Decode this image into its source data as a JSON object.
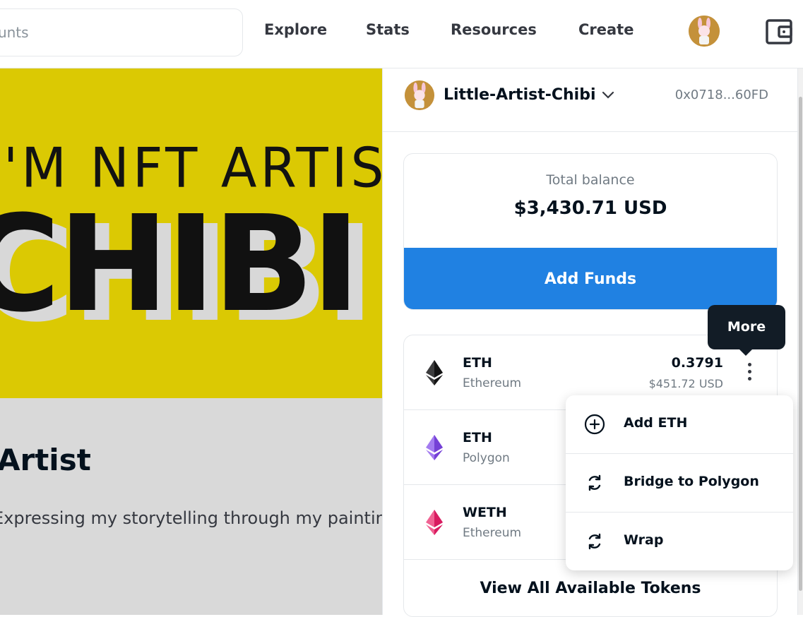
{
  "header": {
    "search_placeholder": "Search items, collections, and accounts",
    "nav": [
      "Explore",
      "Stats",
      "Resources",
      "Create"
    ]
  },
  "profile": {
    "banner_line1": "I'M NFT ARTIST",
    "banner_line2": "CHIBI",
    "title": "Artist",
    "description": "Expressing my storytelling through my paintings. ..."
  },
  "wallet": {
    "account_name": "Little-Artist-Chibi",
    "address": "0x0718...60FD",
    "balance_label": "Total balance",
    "balance_value": "$3,430.71 USD",
    "add_funds_label": "Add Funds",
    "tokens": [
      {
        "symbol": "ETH",
        "chain": "Ethereum",
        "amount": "0.3791",
        "usd": "$451.72 USD",
        "color": "#3c3c3d"
      },
      {
        "symbol": "ETH",
        "chain": "Polygon",
        "amount": "",
        "usd": "",
        "color": "#8247e5"
      },
      {
        "symbol": "WETH",
        "chain": "Ethereum",
        "amount": "",
        "usd": "",
        "color": "#ec407a"
      }
    ],
    "view_all_label": "View All Available Tokens"
  },
  "tooltip": {
    "label": "More"
  },
  "menu": {
    "items": [
      {
        "label": "Add ETH",
        "icon": "plus-circle-icon"
      },
      {
        "label": "Bridge to Polygon",
        "icon": "refresh-icon"
      },
      {
        "label": "Wrap",
        "icon": "refresh-icon"
      }
    ]
  },
  "colors": {
    "accent": "#2081e2",
    "banner": "#dbc903",
    "tooltip": "#121c26"
  }
}
